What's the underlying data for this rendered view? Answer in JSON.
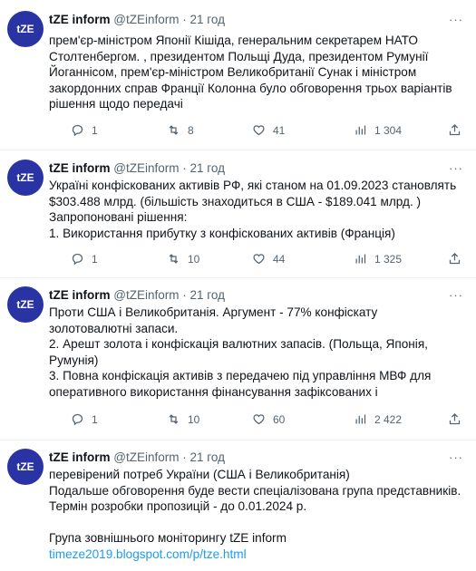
{
  "tweets": [
    {
      "avatar_text": "tZE",
      "name": "tZE inform",
      "handle": "@tZEinform",
      "time": "21 год",
      "text": [
        "прем'єр-міністром Японії Кішіда, генеральним секретарем НАТО",
        "Столтенбергом. , президентом Польщі Дуда, президентом Румунії",
        "Йоганнісом, прем'єр-міністром Великобританії Сунак і міністром",
        "закордонних справ Франції Колонна було обговорення трьох варіантів",
        "рішення щодо передачі"
      ],
      "replies": "1",
      "retweets": "8",
      "likes": "41",
      "views": "1 304"
    },
    {
      "avatar_text": "tZE",
      "name": "tZE inform",
      "handle": "@tZEinform",
      "time": "21 год",
      "text": [
        "Україні конфіскованих активів РФ,   які станом на 01.09.2023 становлять",
        "$303.488 млрд. (більшість  знаходиться в США - $189.041 млрд. )",
        "Запропоновані рішення:",
        "1.  Використання прибутку з конфіскованих активів  (Франція)"
      ],
      "replies": "1",
      "retweets": "10",
      "likes": "44",
      "views": "1 325"
    },
    {
      "avatar_text": "tZE",
      "name": "tZE inform",
      "handle": "@tZEinform",
      "time": "21 год",
      "text": [
        "Проти США і Великобританія. Аргумент - 77% конфіскату",
        "золотовалютні запаси.",
        "2. Арешт золота і конфіскація валютних запасів. (Польща, Японія,",
        "Румунія)",
        "3.  Повна конфіскація активів з передачею під управління МВФ для",
        "оперативного використання фінансування зафіксованих і"
      ],
      "replies": "1",
      "retweets": "10",
      "likes": "60",
      "views": "2 422"
    },
    {
      "avatar_text": "tZE",
      "name": "tZE inform",
      "handle": "@tZEinform",
      "time": "21 год",
      "text": [
        "перевірений потреб України (США і Великобританія)",
        "Подальше обговорення буде вести спеціалізована група представників.",
        "Термін розробки пропозицій - до 0.01.2024 р.",
        "",
        "Група зовнішнього моніторингу tZE inform"
      ],
      "link": "timeze2019.blogspot.com/p/tze.html"
    }
  ],
  "more_label": "···",
  "separator": "·"
}
